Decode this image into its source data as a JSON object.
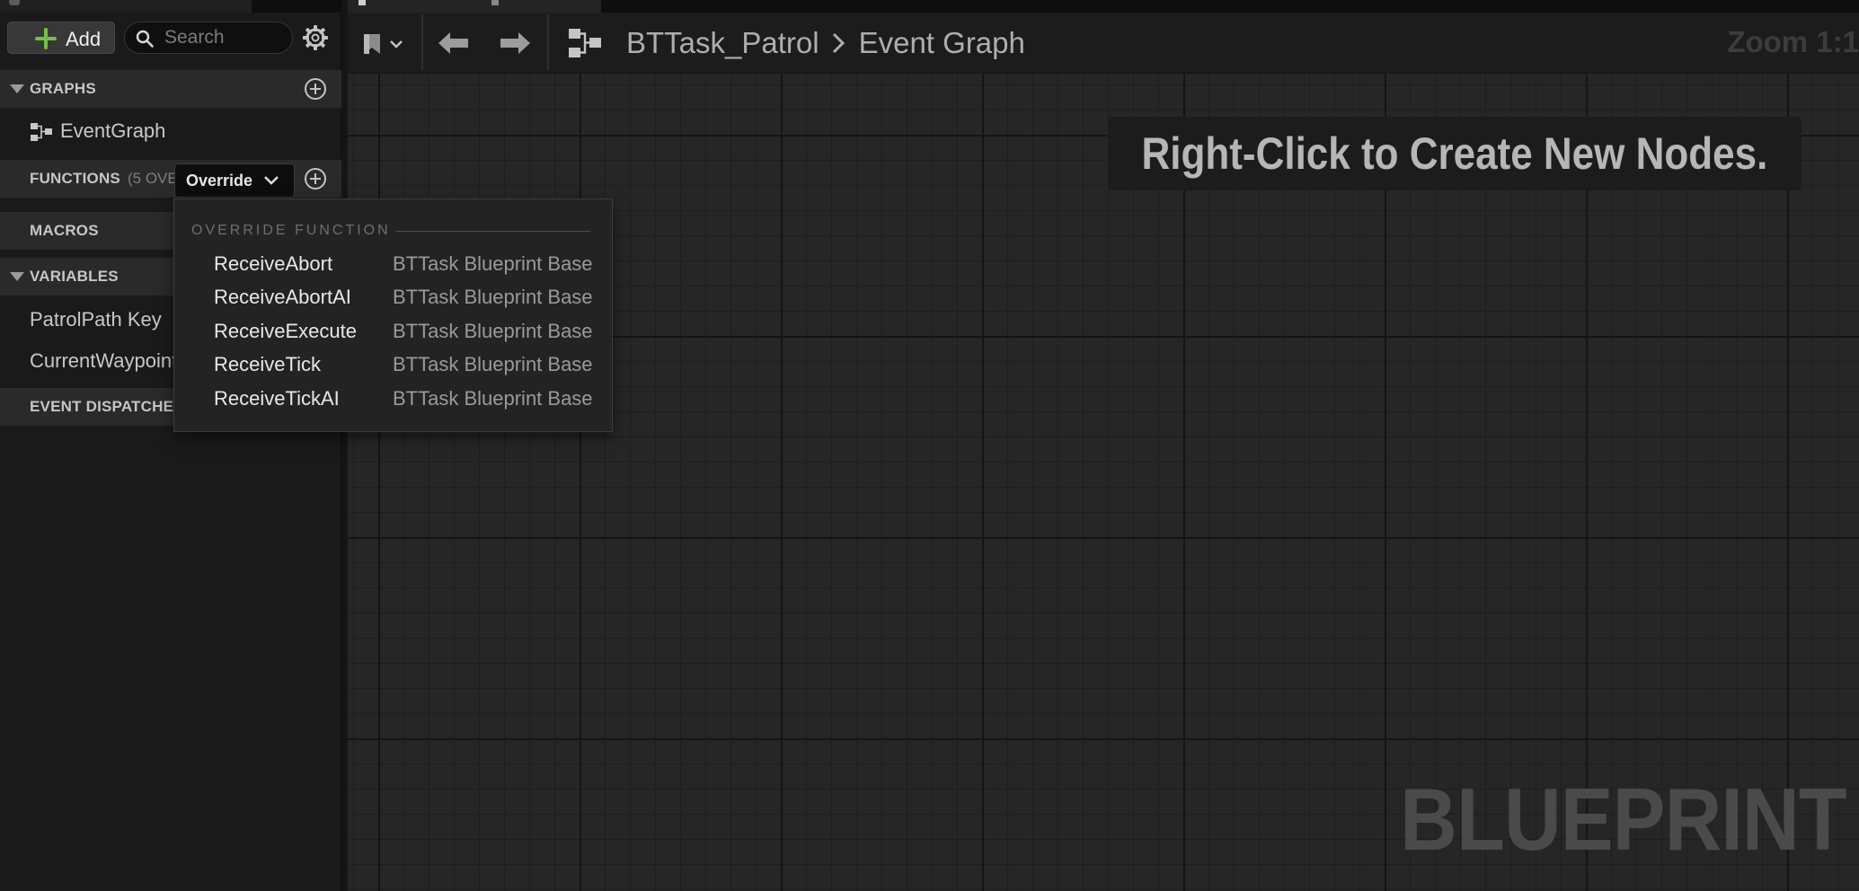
{
  "toolbar_left": {
    "add_label": "Add",
    "search_placeholder": "Search"
  },
  "sections": {
    "graphs": {
      "label": "GRAPHS",
      "items": [
        {
          "label": "EventGraph"
        }
      ]
    },
    "functions": {
      "label": "FUNCTIONS",
      "count_text": "(5 OVE",
      "override_label": "Override"
    },
    "macros": {
      "label": "MACROS"
    },
    "variables": {
      "label": "VARIABLES",
      "items": [
        {
          "label": "PatrolPath Key"
        },
        {
          "label": "CurrentWaypoint"
        }
      ]
    },
    "dispatchers": {
      "label": "EVENT DISPATCHERS"
    }
  },
  "override_menu": {
    "header": "OVERRIDE FUNCTION",
    "items": [
      {
        "name": "ReceiveAbort",
        "owner": "BTTask Blueprint Base"
      },
      {
        "name": "ReceiveAbortAI",
        "owner": "BTTask Blueprint Base"
      },
      {
        "name": "ReceiveExecute",
        "owner": "BTTask Blueprint Base"
      },
      {
        "name": "ReceiveTick",
        "owner": "BTTask Blueprint Base"
      },
      {
        "name": "ReceiveTickAI",
        "owner": "BTTask Blueprint Base"
      }
    ]
  },
  "graph": {
    "breadcrumb": [
      "BTTask_Patrol",
      "Event Graph"
    ],
    "zoom_text": "Zoom 1:1",
    "hint": "Right-Click to Create New Nodes.",
    "watermark": "BLUEPRINT"
  },
  "colors": {
    "accent_green": "#74c043",
    "panel_bg": "#1a1a1a",
    "graph_bg": "#262626"
  },
  "icons": {
    "add": "plus-icon",
    "search": "search-icon",
    "settings": "gear-icon",
    "section_add": "add-circle-icon",
    "graph": "graph-icon",
    "bookmark": "bookmark-icon",
    "back": "arrow-left-icon",
    "forward": "arrow-right-icon",
    "breadcrumb_separator": "chevron-right-icon"
  }
}
